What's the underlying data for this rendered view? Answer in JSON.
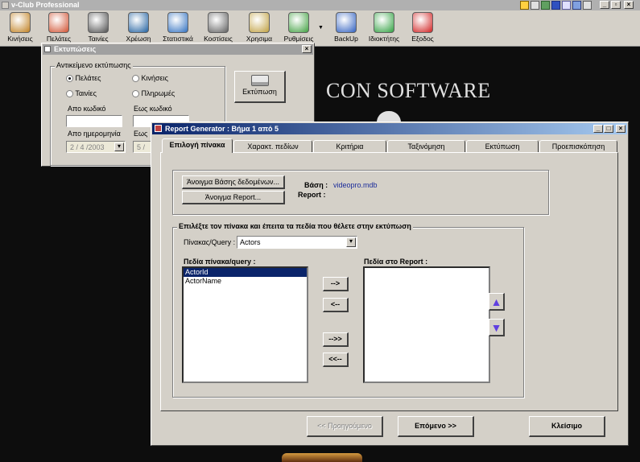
{
  "app": {
    "title": "v-Club Professional"
  },
  "toolbar": {
    "items": [
      {
        "label": "Κινήσεις",
        "icon": "film-clapper-icon",
        "color": "#c08020"
      },
      {
        "label": "Πελάτες",
        "icon": "users-icon",
        "color": "#d05030"
      },
      {
        "label": "Ταινίες",
        "icon": "film-reel-icon",
        "color": "#505050"
      },
      {
        "label": "Χρέωση",
        "icon": "money-icon",
        "color": "#2060a0"
      },
      {
        "label": "Στατιστικά",
        "icon": "pie-chart-icon",
        "color": "#3070c0"
      },
      {
        "label": "Κοστίσεις",
        "icon": "computer-icon",
        "color": "#606060"
      },
      {
        "label": "Χρησιμα",
        "icon": "folder-icon",
        "color": "#c0a040"
      },
      {
        "label": "Ρυθμίσεις",
        "icon": "settings-icon",
        "color": "#40a040"
      },
      {
        "label": "BackUp",
        "icon": "backup-icon",
        "color": "#3060c0"
      },
      {
        "label": "Ιδιοκτήτης",
        "icon": "owner-icon",
        "color": "#30a040"
      },
      {
        "label": "Εξοδος",
        "icon": "exit-icon",
        "color": "#d02020"
      }
    ]
  },
  "background": {
    "brand_text": "CON SOFTWARE"
  },
  "printdlg": {
    "title": "Εκτυπώσεις",
    "group_label": "Αντικείμενο εκτύπωσης",
    "radios": [
      "Πελάτες",
      "Κινήσεις",
      "Ταινίες",
      "Πληρωμές"
    ],
    "from_code_label": "Απο κωδικό",
    "to_code_label": "Εως κωδικό",
    "from_date_label": "Απο ημερομηνία",
    "to_date_label": "Εως",
    "from_date_value": "2 / 4 /2003",
    "to_date_value": "5 /",
    "print_button": "Εκτύπωση"
  },
  "report": {
    "title": "Report Generator : Βήμα 1 από 5",
    "tabs": [
      "Επιλογή πίνακα",
      "Χαρακτ. πεδίων",
      "Κριτήρια",
      "Ταξινόμηση",
      "Εκτύπωση",
      "Προεπισκόπηση"
    ],
    "open_db_button": "Άνοιγμα Βάσης δεδομένων...",
    "open_report_button": "Άνοιγμα Report...",
    "db_label": "Βάση :",
    "db_value": "videopro.mdb",
    "report_label": "Report :",
    "report_value": "",
    "select_group_label": "Επιλέξτε τον πίνακα και έπειτα τα πεδία που θέλετε στην εκτύπωση",
    "table_query_label": "Πίνακας/Query :",
    "table_query_value": "Actors",
    "fields_label": "Πεδία πίνακα/query :",
    "fields": [
      "ActorId",
      "ActorName"
    ],
    "report_fields_label": "Πεδία στο Report :",
    "move_right": "-->",
    "move_left": "<--",
    "move_all_right": "-->>",
    "move_all_left": "<<--",
    "prev_button": "<< Προηγούμενο",
    "next_button": "Επόμενο >>",
    "close_button": "Κλείσιμο"
  }
}
